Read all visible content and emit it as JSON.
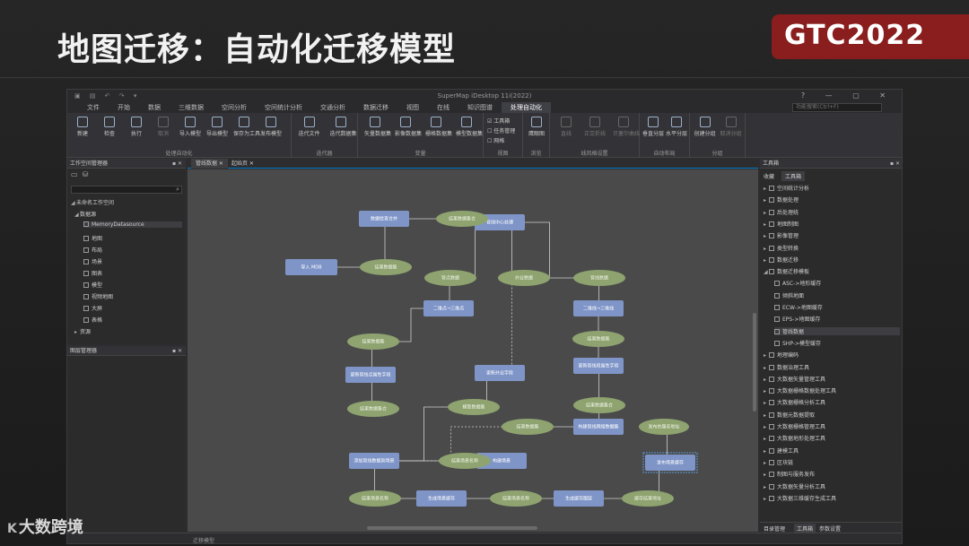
{
  "slide": {
    "title": "地图迁移：自动化迁移模型",
    "gtc_badge": "GTC2022",
    "corner_brand": "大数跨境",
    "corner_logo": "K"
  },
  "app": {
    "window_title": "SuperMap iDesktop 11i(2022)",
    "menu": [
      "文件",
      "开始",
      "数据",
      "三维数据",
      "空间分析",
      "空间统计分析",
      "交通分析",
      "数据迁移",
      "视图",
      "在线",
      "知识图谱",
      "处理自动化"
    ],
    "active_menu": "处理自动化",
    "search_placeholder": "功能搜索(Ctrl+F)",
    "ribbon": {
      "groups": [
        {
          "label": "处理自动化",
          "buttons": [
            "新建",
            "检查",
            "执行",
            "取消",
            "导入模型",
            "导出模型",
            "保存为工具",
            "发布模型"
          ]
        },
        {
          "label": "迭代器",
          "buttons": [
            "迭代文件",
            "迭代数据集"
          ]
        },
        {
          "label": "变量",
          "buttons": [
            "矢量数据集",
            "影像数据集",
            "栅格数据集",
            "模型数据集"
          ]
        },
        {
          "label": "视图",
          "checks": [
            "工具箱",
            "任务管理",
            "网格"
          ]
        },
        {
          "label": "浏览",
          "buttons": [
            "鹰眼图"
          ]
        },
        {
          "label": "线风格设置",
          "buttons": [
            "直线",
            "正交折线",
            "贝塞尔曲线"
          ]
        },
        {
          "label": "自动布局",
          "buttons": [
            "垂直分层",
            "水平分层"
          ]
        },
        {
          "label": "分组",
          "buttons": [
            "创建分组",
            "取消分组"
          ]
        }
      ]
    },
    "workspace_panel": {
      "title": "工作空间管理器",
      "root": "未命名工作空间",
      "datasources": "数据源",
      "memory_ds": "MemoryDatasource",
      "items": [
        "地图",
        "布局",
        "场景",
        "图表",
        "模型",
        "视频地图",
        "大屏",
        "表格",
        "资源"
      ]
    },
    "layer_panel": {
      "title": "图层管理器"
    },
    "doc_tabs": [
      "管线数据",
      "起始页"
    ],
    "toolbox": {
      "title": "工具箱",
      "tabs": [
        "收藏",
        "工具箱"
      ],
      "items": [
        "空间统计分析",
        "数据处理",
        "后处理统",
        "地图制图",
        "影像管理",
        "类型转换",
        "数据迁移",
        "数据迁移模板",
        "ASC->地形缓存",
        "倾斜地面",
        "ECW->地图缓存",
        "EPS->地图缓存",
        "管线数据",
        "SHP->模型缓存",
        "地理编码",
        "数据治理工具",
        "大数据矢量管理工具",
        "大数据栅格数据处理工具",
        "大数据栅格分析工具",
        "数据元数据提取",
        "大数据栅格管理工具",
        "大数据地形处理工具",
        "建模工具",
        "区块链",
        "制图与服务发布",
        "大数据矢量分析工具",
        "大数据三维缓存生成工具"
      ],
      "bottom_tabs": [
        "目录管理",
        "工具箱",
        "参数设置"
      ]
    },
    "status_text": "迁移模型"
  },
  "model": {
    "rect_nodes": [
      {
        "id": "import",
        "label": "导入 MDB"
      },
      {
        "id": "check",
        "label": "数据检查合并"
      },
      {
        "id": "vertical",
        "label": "管线中心处理"
      },
      {
        "id": "conv_l",
        "label": "二维点→三维点"
      },
      {
        "id": "conv_r",
        "label": "二维线→三维线"
      },
      {
        "id": "attr_l",
        "label": "更新管线点属性字段"
      },
      {
        "id": "mid",
        "label": "更新外业字段"
      },
      {
        "id": "attr_r",
        "label": "更新管线段属性字段"
      },
      {
        "id": "build_r",
        "label": "构建管线网络数据集"
      },
      {
        "id": "fields",
        "label": "添加管线数据到场景"
      },
      {
        "id": "build",
        "label": "构建场景"
      },
      {
        "id": "gen",
        "label": "生成场景缓存"
      },
      {
        "id": "cache",
        "label": "生成缓存图层"
      },
      {
        "id": "publish",
        "label": "发布场景缓存"
      }
    ],
    "ellipse_nodes": [
      {
        "id": "e1",
        "label": "结果数据集"
      },
      {
        "id": "e2",
        "label": "结果数据集合"
      },
      {
        "id": "e3",
        "label": "管点数据"
      },
      {
        "id": "e4",
        "label": "外业数据"
      },
      {
        "id": "e5",
        "label": "管线数据"
      },
      {
        "id": "e6",
        "label": "结果数据集"
      },
      {
        "id": "e7",
        "label": "结果数据集"
      },
      {
        "id": "e8",
        "label": "结果数据集合"
      },
      {
        "id": "e9",
        "label": "模型数据集"
      },
      {
        "id": "e10",
        "label": "结果数据集合"
      },
      {
        "id": "e11",
        "label": "结果数据集"
      },
      {
        "id": "e12",
        "label": "结果场景名称"
      },
      {
        "id": "e13",
        "label": "结果场景名称"
      },
      {
        "id": "e14",
        "label": "结果场景名称"
      },
      {
        "id": "e15",
        "label": "缓存结果地址"
      }
    ],
    "note_nodes": [
      {
        "id": "n1",
        "label": "发布的服务地址"
      }
    ]
  },
  "colors": {
    "rect": "#7f95c8",
    "ellipse": "#8ea36f",
    "edge": "#cfcfcf",
    "selected": "#5b9bd5",
    "gtc_red": "#8a1d1d"
  }
}
